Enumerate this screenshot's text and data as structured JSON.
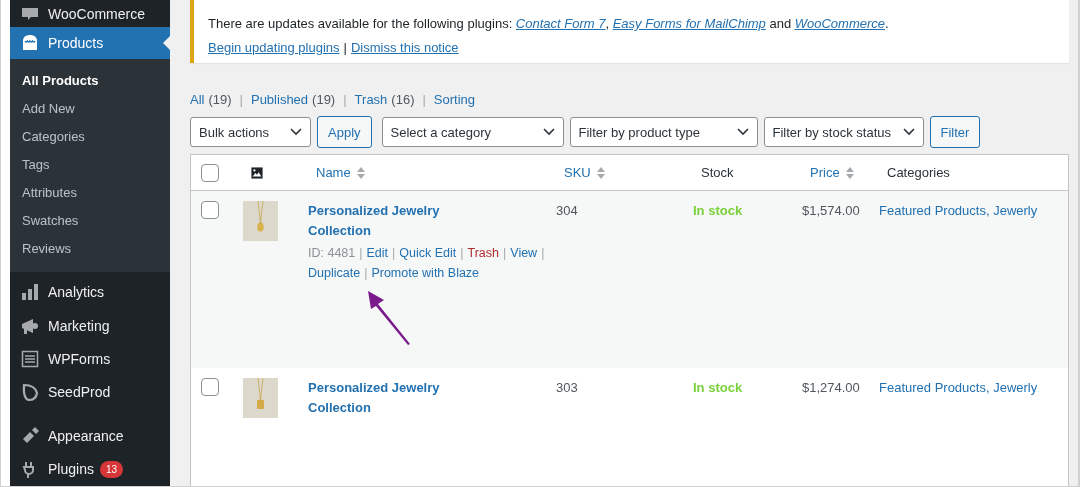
{
  "sidebar": {
    "items": [
      {
        "kind": "item",
        "label": "WooCommerce",
        "selected": false
      },
      {
        "kind": "item",
        "label": "Products",
        "selected": true,
        "children": [
          {
            "label": "All Products",
            "selected": true
          },
          {
            "label": "Add New",
            "selected": false
          },
          {
            "label": "Categories",
            "selected": false
          },
          {
            "label": "Tags",
            "selected": false
          },
          {
            "label": "Attributes",
            "selected": false
          },
          {
            "label": "Swatches",
            "selected": false
          },
          {
            "label": "Reviews",
            "selected": false
          }
        ]
      },
      {
        "kind": "item",
        "label": "Analytics",
        "selected": false
      },
      {
        "kind": "item",
        "label": "Marketing",
        "selected": false
      },
      {
        "kind": "item",
        "label": "WPForms",
        "selected": false
      },
      {
        "kind": "item",
        "label": "SeedProd",
        "selected": false
      },
      {
        "kind": "separator"
      },
      {
        "kind": "item",
        "label": "Appearance",
        "selected": false
      },
      {
        "kind": "item",
        "label": "Plugins",
        "selected": false,
        "badge": "13"
      }
    ]
  },
  "notice": {
    "message": [
      {
        "kind": "text",
        "text": "There are updates available for the following plugins: "
      },
      {
        "kind": "link",
        "text": "Contact Form 7"
      },
      {
        "kind": "text",
        "text": ", "
      },
      {
        "kind": "link",
        "text": "Easy Forms for MailChimp"
      },
      {
        "kind": "text",
        "text": " and "
      },
      {
        "kind": "link",
        "text": "WooCommerce"
      },
      {
        "kind": "text",
        "text": "."
      }
    ],
    "actions": [
      {
        "kind": "link",
        "text": "Begin updating plugins"
      },
      {
        "kind": "separator",
        "text": "|"
      },
      {
        "kind": "link",
        "text": "Dismiss this notice"
      }
    ]
  },
  "views": [
    {
      "kind": "link",
      "label": "All",
      "count": "(19)"
    },
    {
      "kind": "separator",
      "label": "|"
    },
    {
      "kind": "link",
      "label": "Published",
      "count": "(19)"
    },
    {
      "kind": "separator",
      "label": "|"
    },
    {
      "kind": "link",
      "label": "Trash",
      "count": "(16)"
    },
    {
      "kind": "separator",
      "label": "|"
    },
    {
      "kind": "link",
      "label": "Sorting"
    }
  ],
  "filters": [
    {
      "kind": "select",
      "label": "Bulk actions"
    },
    {
      "kind": "button",
      "label": "Apply"
    },
    {
      "kind": "select",
      "label": "Select a category"
    },
    {
      "kind": "select",
      "label": "Filter by product type"
    },
    {
      "kind": "select",
      "label": "Filter by stock status"
    },
    {
      "kind": "button",
      "label": "Filter"
    }
  ],
  "table": {
    "select_all_checked": false,
    "columns": [
      {
        "label": "Name",
        "sortable": true
      },
      {
        "label": "SKU",
        "sortable": true
      },
      {
        "label": "Stock",
        "sortable": false
      },
      {
        "label": "Price",
        "sortable": true
      },
      {
        "label": "Categories",
        "sortable": false
      }
    ],
    "rows": [
      {
        "checked": false,
        "highlighted": true,
        "name": "Personalized Jewelry Collection",
        "id": "ID: 4481",
        "actions": [
          {
            "label": "|",
            "kind": "separator"
          },
          {
            "label": "Edit",
            "kind": "link"
          },
          {
            "label": "|",
            "kind": "separator"
          },
          {
            "label": "Quick Edit",
            "kind": "link"
          },
          {
            "label": "|",
            "kind": "separator"
          },
          {
            "label": "Trash",
            "kind": "danger"
          },
          {
            "label": "|",
            "kind": "separator"
          },
          {
            "label": "View",
            "kind": "link"
          },
          {
            "label": "|",
            "kind": "separator"
          },
          {
            "label": "Duplicate",
            "kind": "link"
          },
          {
            "label": "|",
            "kind": "separator"
          },
          {
            "label": "Promote with Blaze",
            "kind": "link"
          }
        ],
        "sku": "304",
        "stock": "In stock",
        "price": "$1,574.00",
        "categories": "Featured Products, Jewerly"
      },
      {
        "checked": false,
        "highlighted": false,
        "name": "Personalized Jewelry Collection",
        "sku": "303",
        "stock": "In stock",
        "price": "$1,274.00",
        "categories": "Featured Products, Jewerly"
      }
    ]
  }
}
